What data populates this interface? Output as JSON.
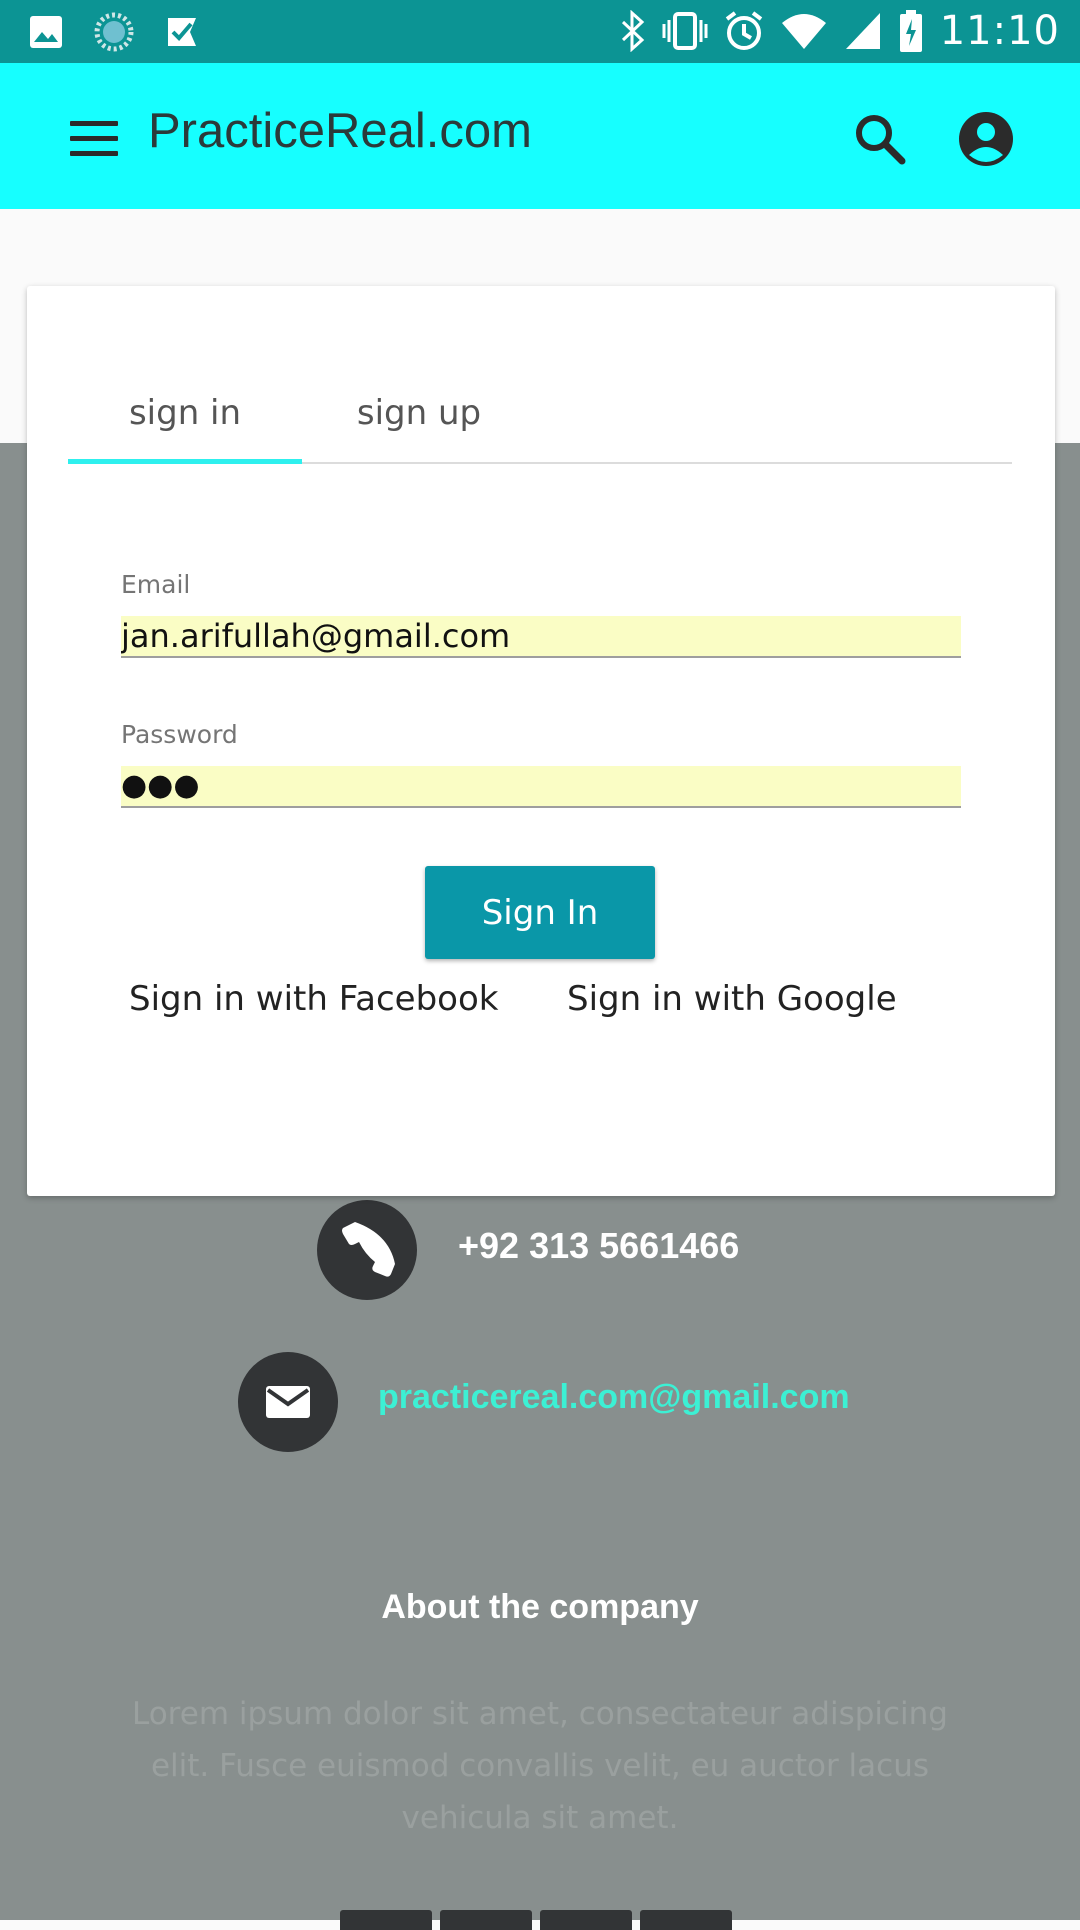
{
  "status_bar": {
    "time": "11:10"
  },
  "app_bar": {
    "title": "PracticeReal.com"
  },
  "auth_card": {
    "tabs": [
      {
        "label": "sign in",
        "active": true
      },
      {
        "label": "sign up",
        "active": false
      }
    ],
    "email": {
      "label": "Email",
      "value": "jan.arifullah@gmail.com"
    },
    "password": {
      "label": "Password",
      "value": "●●●"
    },
    "signin_button": "Sign In",
    "facebook_link": "Sign in with Facebook",
    "google_link": "Sign in with Google"
  },
  "contact": {
    "phone": "+92 313 5661466",
    "email": "practicereal.com@gmail.com"
  },
  "about": {
    "title": "About the company",
    "body": "Lorem ipsum dolor sit amet, consectateur adispicing elit. Fusce euismod convallis velit, eu auctor lacus vehicula sit amet."
  },
  "colors": {
    "status_bar": "#0c9494",
    "app_bar": "#16ffff",
    "accent": "#0a97a8",
    "tab_indicator": "#2ef0ee",
    "footer": "#888f8e",
    "email_link": "#3cf0d4"
  }
}
